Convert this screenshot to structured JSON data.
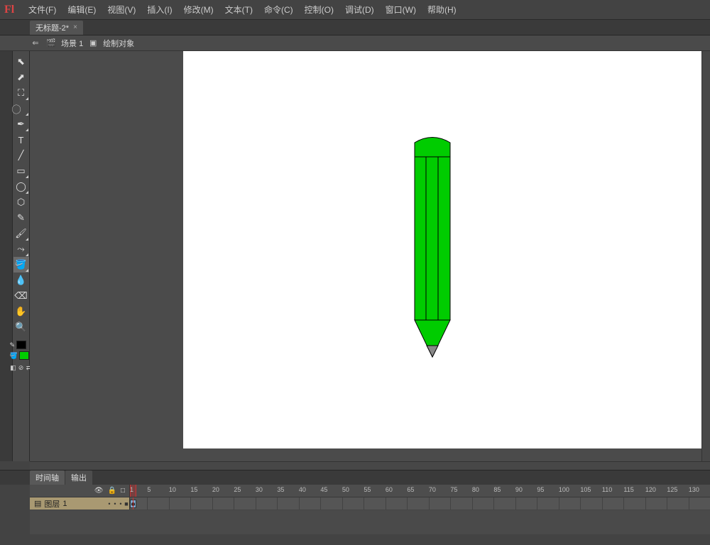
{
  "app": {
    "logo_text": "Fl"
  },
  "menus": [
    "文件(F)",
    "编辑(E)",
    "视图(V)",
    "插入(I)",
    "修改(M)",
    "文本(T)",
    "命令(C)",
    "控制(O)",
    "调试(D)",
    "窗口(W)",
    "帮助(H)"
  ],
  "document": {
    "tab_title": "无标题-2*",
    "close_glyph": "×"
  },
  "edit_bar": {
    "back_glyph": "⇐",
    "clap_glyph": "🎬",
    "scene_label": "场景",
    "scene_num": "1",
    "obj_icon": "▣",
    "obj_label": "绘制对象"
  },
  "tools": [
    {
      "name": "selection-tool",
      "glyph": "⬉",
      "corner": false
    },
    {
      "name": "subselect-tool",
      "glyph": "⬈",
      "corner": false
    },
    {
      "name": "free-transform-tool",
      "glyph": "⛶",
      "corner": true
    },
    {
      "name": "lasso-tool",
      "glyph": "⃝",
      "corner": true
    },
    {
      "name": "pen-tool",
      "glyph": "✒",
      "corner": true
    },
    {
      "name": "text-tool",
      "glyph": "T",
      "corner": false
    },
    {
      "name": "line-tool",
      "glyph": "╱",
      "corner": false
    },
    {
      "name": "rectangle-tool",
      "glyph": "▭",
      "corner": true
    },
    {
      "name": "oval-tool",
      "glyph": "◯",
      "corner": true
    },
    {
      "name": "polystar-tool",
      "glyph": "⬡",
      "corner": false
    },
    {
      "name": "pencil-tool",
      "glyph": "✎",
      "corner": false
    },
    {
      "name": "brush-tool",
      "glyph": "🖌",
      "corner": true
    },
    {
      "name": "bone-tool",
      "glyph": "⤳",
      "corner": true
    },
    {
      "name": "paint-bucket-tool",
      "glyph": "🪣",
      "corner": true
    },
    {
      "name": "eyedropper-tool",
      "glyph": "💧",
      "corner": false
    },
    {
      "name": "eraser-tool",
      "glyph": "⌫",
      "corner": false
    },
    {
      "name": "hand-tool",
      "glyph": "✋",
      "corner": false
    },
    {
      "name": "zoom-tool",
      "glyph": "🔍",
      "corner": false
    }
  ],
  "colors": {
    "stroke": "#000000",
    "fill": "#00cc00"
  },
  "timeline": {
    "tabs": [
      "时间轴",
      "输出"
    ],
    "active_tab": 0,
    "header_icons": [
      "👁",
      "🔒",
      "□"
    ],
    "layer_name": "图层",
    "layer_num": "1",
    "current_frame": 1,
    "ruler_marks": [
      1,
      5,
      10,
      15,
      20,
      25,
      30,
      35,
      40,
      45,
      50,
      55,
      60,
      65,
      70,
      75,
      80,
      85,
      90,
      95,
      100,
      105,
      110,
      115,
      120,
      125,
      130
    ]
  },
  "chart_data": {
    "type": "table",
    "note": "vector drawing on canvas (green pencil)",
    "fill": "#00cc00",
    "stroke": "#000000"
  }
}
